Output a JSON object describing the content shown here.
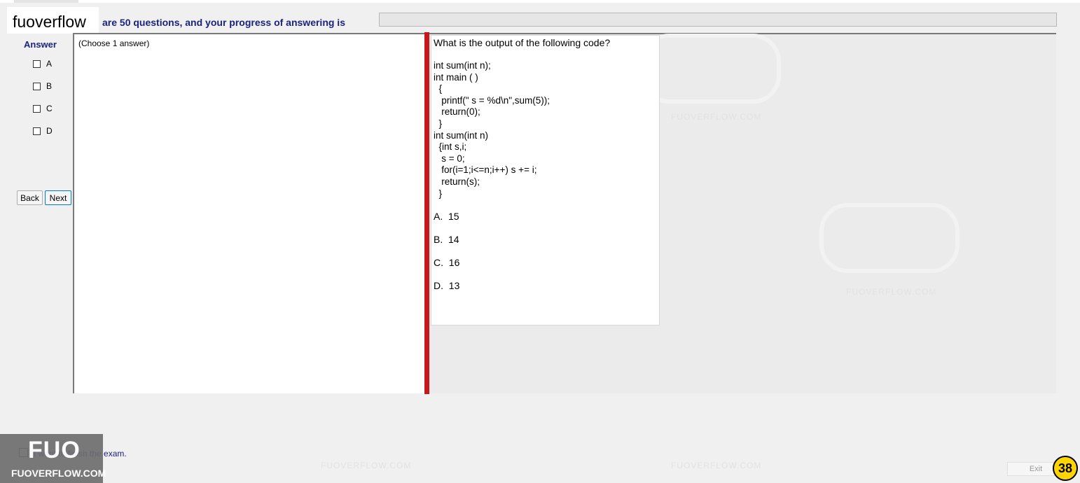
{
  "brand": "fuoverflow",
  "progress": {
    "label": "are 50 questions, and your progress of answering is",
    "value_percent": 0,
    "fill_color": "#06b025"
  },
  "answer_panel": {
    "title": "Answer",
    "options": [
      "A",
      "B",
      "C",
      "D"
    ],
    "back_label": "Back",
    "next_label": "Next"
  },
  "left_pane": {
    "instruction": "(Choose 1 answer)"
  },
  "question": {
    "prompt": "What is the output of the following code?",
    "code": "int sum(int n);\nint main ( )\n  {\n   printf(\" s = %d\\n\",sum(5));\n   return(0);\n  }\nint sum(int n)\n  {int s,i;\n   s = 0;\n   for(i=1;i<=n;i++) s += i;\n   return(s);\n  }",
    "choices": [
      "A.  15",
      "B.  14",
      "C.  16",
      "D.  13"
    ]
  },
  "watermark": "FUOVERFLOW.COM",
  "footer": {
    "finish_label": "I want to finish the exam.",
    "logo_big": "FUO",
    "logo_small": "FUOVERFLOW.COM",
    "exit_label": "Exit",
    "badge": "38"
  },
  "colors": {
    "splitter": "#c8181c",
    "label_blue": "#1a237e",
    "badge": "#ffd400"
  }
}
